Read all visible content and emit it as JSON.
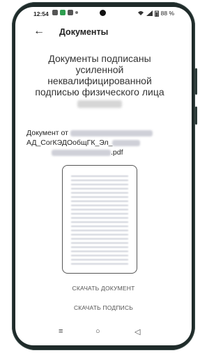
{
  "status_bar": {
    "time": "12:54",
    "battery": "88 %",
    "icons": [
      "notification-icon",
      "app-icon",
      "app-icon",
      "dot-icon",
      "wifi-icon",
      "signal-icon",
      "battery-icon"
    ]
  },
  "app_bar": {
    "back_icon": "←",
    "title": "Документы"
  },
  "content": {
    "heading": "Документы подписаны усиленной неквалифицированной подписью физического лица",
    "doc_prefix": "Документ от",
    "doc_name": "АД_СогКЭДОобщГК_Эл_",
    "doc_ext": ".pdf"
  },
  "actions": {
    "download_document": "СКАЧАТЬ ДОКУМЕНТ",
    "download_signature": "СКАЧАТЬ ПОДПИСЬ"
  },
  "nav": {
    "menu_icon": "≡",
    "home_icon": "○",
    "back_icon": "◁"
  },
  "colors": {
    "frame": "#1f2b2a",
    "background": "#ffffff",
    "text": "#222222",
    "accent_green": "#2e9e4f"
  }
}
